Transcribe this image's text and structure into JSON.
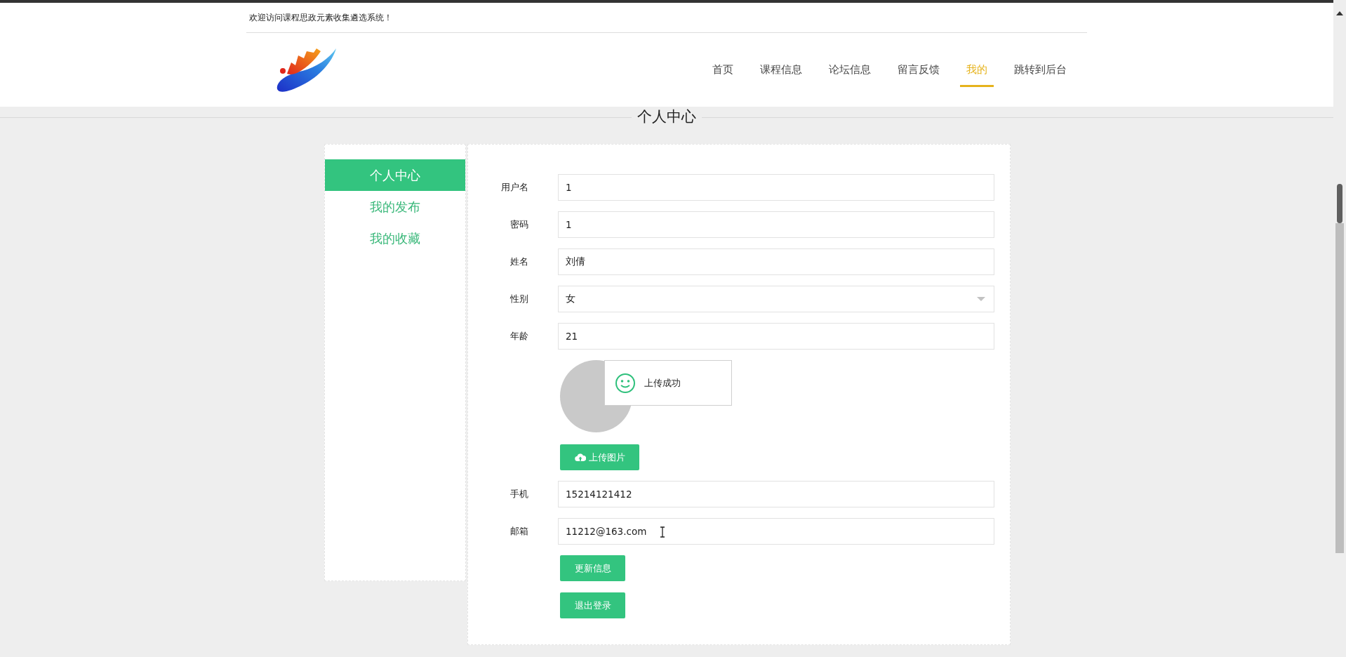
{
  "top_bar": {
    "welcome": "欢迎访问课程思政元素收集遴选系统！"
  },
  "nav": [
    {
      "label": "首页",
      "selected": false
    },
    {
      "label": "课程信息",
      "selected": false
    },
    {
      "label": "论坛信息",
      "selected": false
    },
    {
      "label": "留言反馈",
      "selected": false
    },
    {
      "label": "我的",
      "selected": true
    },
    {
      "label": "跳转到后台",
      "selected": false
    }
  ],
  "page_title": "个人中心",
  "sidebar": {
    "items": [
      {
        "label": "个人中心",
        "selected": true
      },
      {
        "label": "我的发布",
        "selected": false
      },
      {
        "label": "我的收藏",
        "selected": false
      }
    ]
  },
  "form": {
    "fields": [
      {
        "kind": "text",
        "label": "用户名",
        "value": "1"
      },
      {
        "kind": "text",
        "label": "密码",
        "value": "1"
      },
      {
        "kind": "text",
        "label": "姓名",
        "value": "刘倩"
      },
      {
        "kind": "select",
        "label": "性别",
        "value": "女"
      },
      {
        "kind": "text",
        "label": "年龄",
        "value": "21"
      },
      {
        "kind": "image",
        "button": "上传图片",
        "toast": "上传成功"
      },
      {
        "kind": "text",
        "label": "手机",
        "value": "15214121412"
      },
      {
        "kind": "text",
        "label": "邮箱",
        "value": "11212@163.com",
        "cursor": true
      }
    ],
    "buttons": [
      "更新信息",
      "退出登录"
    ]
  }
}
